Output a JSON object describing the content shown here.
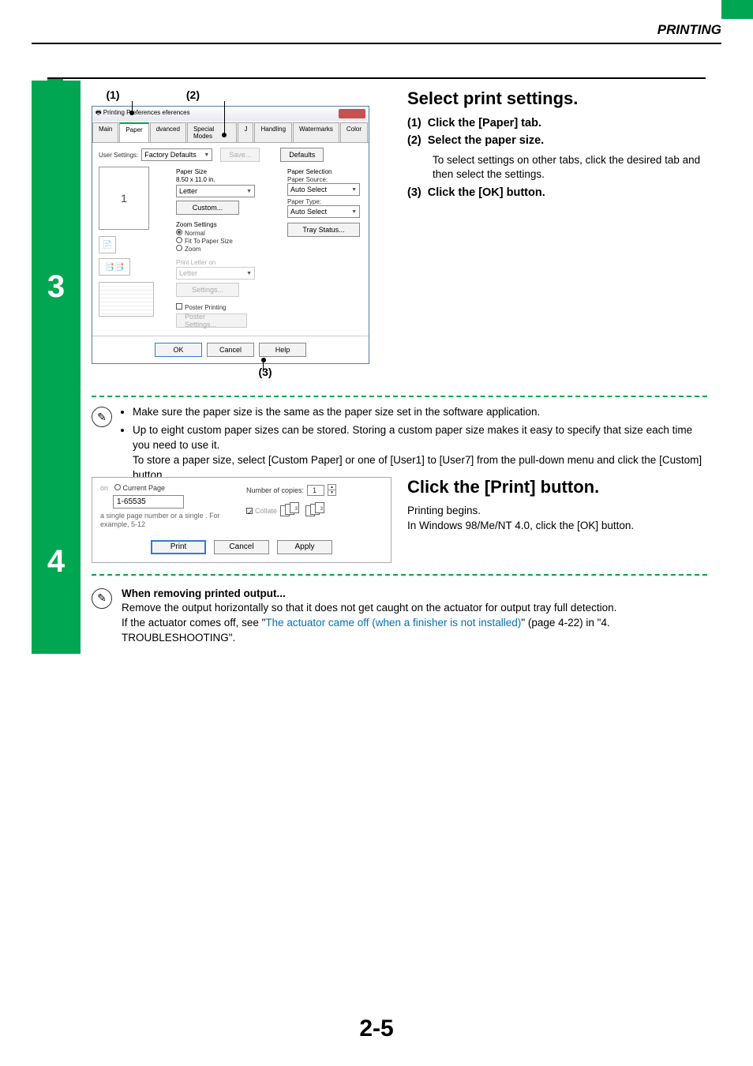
{
  "header": {
    "title": "PRINTING"
  },
  "step3": {
    "number": "3",
    "callouts": {
      "c1": "(1)",
      "c2": "(2)",
      "c3": "(3)"
    },
    "dialog": {
      "title": "Printing Preferences",
      "tabs": [
        "Main",
        "Paper",
        "Advanced",
        "Special Modes",
        "Job Handling",
        "Watermarks",
        "Color"
      ],
      "tabs_short": {
        "t0": "Main",
        "t1": "Paper",
        "t2": "dvanced",
        "t3": "Special Modes",
        "t4": "J",
        "t5": "Handling",
        "t6": "Watermarks",
        "t7": "Color"
      },
      "user_settings_label": "User Settings:",
      "user_settings_value": "Factory Defaults",
      "save": "Save...",
      "defaults": "Defaults",
      "paper_size_label": "Paper Size",
      "paper_size_dim": "8.50 x 11.0 in.",
      "paper_size_value": "Letter",
      "custom": "Custom...",
      "zoom_label": "Zoom Settings",
      "zoom_normal": "Normal",
      "zoom_fit": "Fit To Paper Size",
      "zoom_zoom": "Zoom",
      "print_on_label": "Print Letter on",
      "print_on_value": "Letter",
      "settings": "Settings...",
      "poster_chk": "Poster Printing",
      "poster_btn": "Poster Settings...",
      "paper_selection": "Paper Selection",
      "paper_source_label": "Paper Source:",
      "paper_source_value": "Auto Select",
      "paper_type_label": "Paper Type:",
      "paper_type_value": "Auto Select",
      "tray_status": "Tray Status...",
      "preview_num": "1",
      "ok": "OK",
      "cancel": "Cancel",
      "help": "Help"
    },
    "instructions": {
      "title": "Select print settings.",
      "i1_n": "(1)",
      "i1_t": "Click the [Paper] tab.",
      "i2_n": "(2)",
      "i2_t": "Select the paper size.",
      "i2_sub": "To select settings on other tabs, click the desired tab and then select the settings.",
      "i3_n": "(3)",
      "i3_t": "Click the [OK] button."
    },
    "notes": {
      "b1": "Make sure the paper size is the same as the paper size set in the software application.",
      "b2": "Up to eight custom paper sizes can be stored. Storing a custom paper size makes it easy to specify that size each time you need to use it.",
      "b2_sub": "To store a paper size, select [Custom Paper] or one of [User1] to [User7] from the pull-down menu and click the [Custom] button."
    }
  },
  "step4": {
    "number": "4",
    "dialog": {
      "current_page": "Current Page",
      "range": "1-65535",
      "hint": "a single page number or a single .  For example, 5-12",
      "copies_label": "Number of copies:",
      "copies_value": "1",
      "collate": "Collate",
      "print": "Print",
      "cancel": "Cancel",
      "apply": "Apply",
      "frag": "on"
    },
    "instructions": {
      "title": "Click the [Print] button.",
      "p1": "Printing begins.",
      "p2": "In Windows 98/Me/NT 4.0, click the [OK] button."
    },
    "notes": {
      "heading": "When removing printed output...",
      "line1": "Remove the output horizontally so that it does not get caught on the actuator for output tray full detection.",
      "line2a": "If the actuator comes off, see \"",
      "link": "The actuator came off (when a finisher is not installed)",
      "line2b": "\" (page 4-22) in \"4. TROUBLESHOOTING\"."
    }
  },
  "page_number": "2-5"
}
